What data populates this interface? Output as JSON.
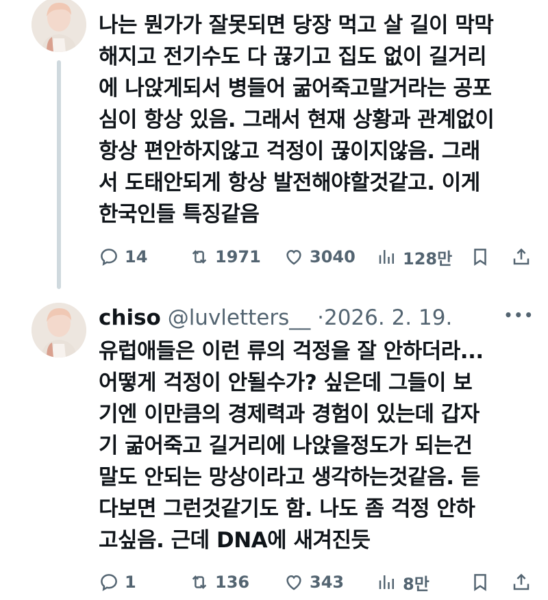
{
  "tweet1": {
    "lines": [
      "나는 뭔가가 잘못되면 당장 먹고 살 길이 막막",
      "해지고 전기수도 다 끊기고 집도 없이 길거리",
      "에 나앉게되서 병들어 굶어죽고말거라는 공포",
      "심이 항상 있음. 그래서 현재 상황과 관계없이",
      "항상 편안하지않고 걱정이 끊이지않음. 그래",
      "서 도태안되게 항상 발전해야할것같고. 이게",
      "한국인들 특징같음"
    ],
    "replies": "14",
    "retweets": "1971",
    "likes": "3040",
    "views": "128만"
  },
  "tweet2": {
    "name": "chiso",
    "handle": "@luvletters__",
    "separator": "·",
    "date": "2026. 2. 19.",
    "lines": [
      "유럽애들은 이런 류의 걱정을 잘 안하더라...",
      "어떻게 걱정이 안될수가? 싶은데 그들이 보",
      "기엔 이만큼의 경제력과 경험이 있는데 갑자",
      "기 굶어죽고 길거리에 나앉을정도가 되는건",
      "말도 안되는 망상이라고 생각하는것같음. 듣",
      "다보면 그런것같기도 함. 나도 좀 걱정 안하",
      "고싶음. 근데 DNA에 새겨진듯"
    ],
    "replies": "1",
    "retweets": "136",
    "likes": "343",
    "views": "8만"
  },
  "icons": {
    "reply": "reply-icon",
    "retweet": "retweet-icon",
    "like": "heart-icon",
    "views": "views-icon",
    "bookmark": "bookmark-icon",
    "share": "share-icon",
    "more": "more-icon"
  },
  "colors": {
    "text": "#0f1419",
    "secondary": "#536471",
    "thread_line": "#cfd9de"
  }
}
